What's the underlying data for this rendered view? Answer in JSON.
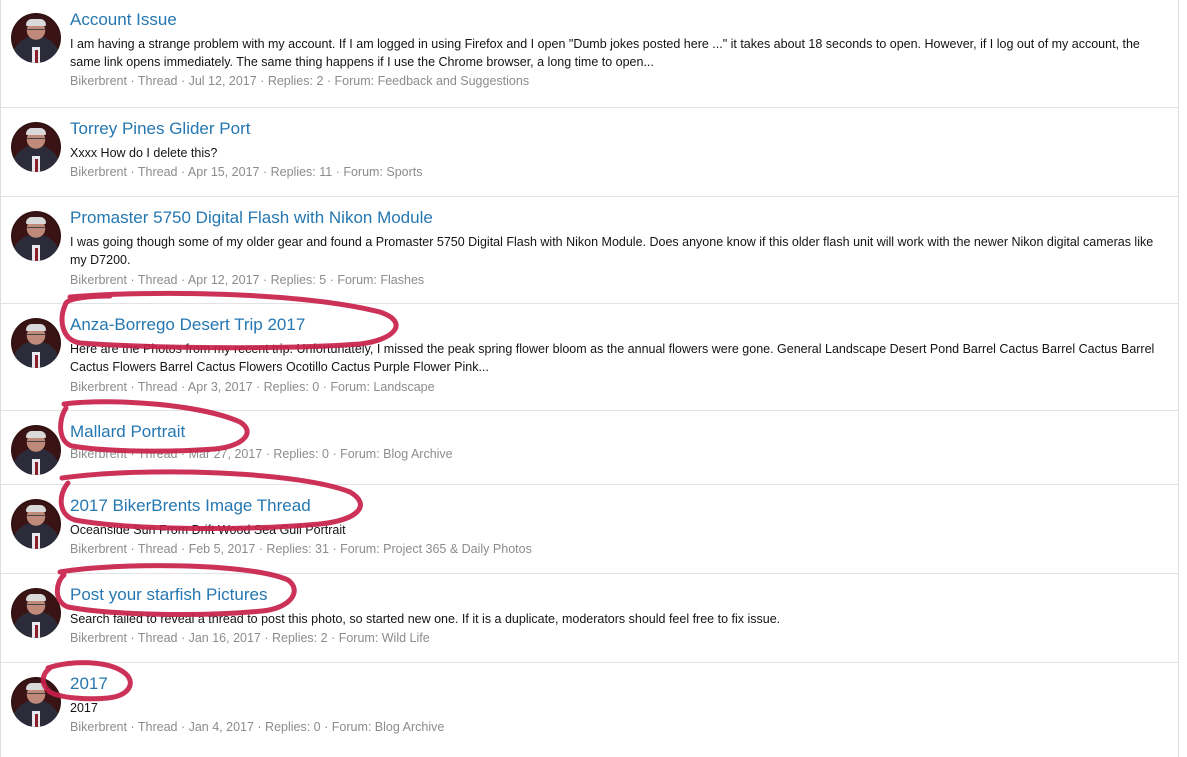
{
  "threads": [
    {
      "title": "Account Issue",
      "snippet": "I am having a strange problem with my account. If I am logged in using Firefox and I open \"Dumb jokes posted here ...\" it takes about 18 seconds to open. However, if I log out of my account, the same link opens immediately. The same thing happens if I use the Chrome browser, a long time to open...",
      "author": "Bikerbrent",
      "type": "Thread",
      "date": "Jul 12, 2017",
      "replies": "Replies: 2",
      "forum": "Forum: Feedback and Suggestions"
    },
    {
      "title": "Torrey Pines Glider Port",
      "snippet": "Xxxx How do I delete this?",
      "author": "Bikerbrent",
      "type": "Thread",
      "date": "Apr 15, 2017",
      "replies": "Replies: 11",
      "forum": "Forum: Sports"
    },
    {
      "title": "Promaster 5750 Digital Flash with Nikon Module",
      "snippet": "I was going though some of my older gear and found a Promaster 5750 Digital Flash with Nikon Module. Does anyone know if this older flash unit will work with the newer Nikon digital cameras like my D7200.",
      "author": "Bikerbrent",
      "type": "Thread",
      "date": "Apr 12, 2017",
      "replies": "Replies: 5",
      "forum": "Forum: Flashes"
    },
    {
      "title": "Anza-Borrego Desert Trip 2017",
      "snippet": "Here are the Photos from my recent trip. Unfortunately, I missed the peak spring flower bloom as the annual flowers were gone. General Landscape Desert Pond Barrel Cactus Barrel Cactus Barrel Cactus Flowers Barrel Cactus Flowers Ocotillo Cactus Purple Flower Pink...",
      "author": "Bikerbrent",
      "type": "Thread",
      "date": "Apr 3, 2017",
      "replies": "Replies: 0",
      "forum": "Forum: Landscape"
    },
    {
      "title": "Mallard Portrait",
      "snippet": "",
      "author": "Bikerbrent",
      "type": "Thread",
      "date": "Mar 27, 2017",
      "replies": "Replies: 0",
      "forum": "Forum: Blog Archive"
    },
    {
      "title": "2017 BikerBrents Image Thread",
      "snippet": "Oceanside Sun From Drift Wood Sea Gull Portrait",
      "author": "Bikerbrent",
      "type": "Thread",
      "date": "Feb 5, 2017",
      "replies": "Replies: 31",
      "forum": "Forum: Project 365 & Daily Photos"
    },
    {
      "title": "Post your starfish Pictures",
      "snippet": "Search failed to reveal a thread to post this photo, so started new one. If it is a duplicate, moderators should feel free to fix issue.",
      "author": "Bikerbrent",
      "type": "Thread",
      "date": "Jan 16, 2017",
      "replies": "Replies: 2",
      "forum": "Forum: Wild Life"
    },
    {
      "title": "2017",
      "snippet": "2017",
      "author": "Bikerbrent",
      "type": "Thread",
      "date": "Jan 4, 2017",
      "replies": "Replies: 0",
      "forum": "Forum: Blog Archive"
    }
  ],
  "meta_separator": " · ",
  "colors": {
    "link": "#2577b1",
    "meta": "#8c8c8c",
    "annotation": "#c8214a"
  },
  "icons": {
    "avatar": "user-avatar-icon"
  }
}
